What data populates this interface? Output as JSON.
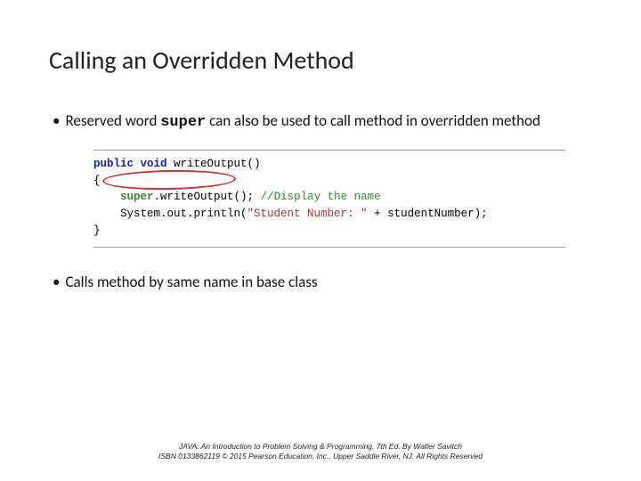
{
  "title": "Calling an Overridden Method",
  "bullet1_pre": "Reserved word ",
  "bullet1_kw": "super",
  "bullet1_post": " can also be used to call method in overridden method",
  "bullet2": "Calls method by same name in base class",
  "code": {
    "kw_public": "public",
    "kw_void": "void",
    "sig_rest": " writeOutput()",
    "open": "{",
    "kw_super": "super",
    "call_rest": ".writeOutput(); ",
    "comment": "//Display the name",
    "sys": "    System.out.println(",
    "str": "\"Student Number: \"",
    "after_str": " + studentNumber);",
    "close": "}"
  },
  "footer": {
    "line1_title": "JAVA: An Introduction to Problem Solving & Programming",
    "line1_rest": ", 7th Ed. By Walter Savitch",
    "line2": "ISBN 0133862119 © 2015 Pearson Education, Inc., Upper Saddle River, NJ. All Rights Reserved"
  }
}
